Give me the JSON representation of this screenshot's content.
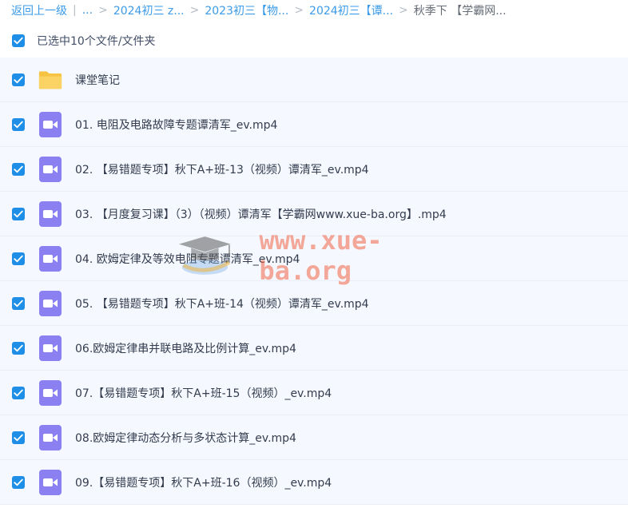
{
  "breadcrumb": {
    "back": "返回上一级",
    "sep": "|",
    "ellipsis": "...",
    "arrow": ">",
    "items": [
      "2024初三 z...",
      "2023初三【物...",
      "2024初三【谭...",
      "秋季下 【学霸网..."
    ]
  },
  "selection": {
    "label": "已选中10个文件/文件夹"
  },
  "files": [
    {
      "name": "课堂笔记",
      "type": "folder"
    },
    {
      "name": "01. 电阻及电路故障专题谭清军_ev.mp4",
      "type": "video"
    },
    {
      "name": "02. 【易错题专项】秋下A+班-13（视频）谭清军_ev.mp4",
      "type": "video"
    },
    {
      "name": "03. 【月度复习课】（3）（视频）谭清军【学霸网www.xue-ba.org】.mp4",
      "type": "video"
    },
    {
      "name": "04. 欧姆定律及等效电阻专题谭清军_ev.mp4",
      "type": "video"
    },
    {
      "name": "05. 【易错题专项】秋下A+班-14（视频）谭清军_ev.mp4",
      "type": "video"
    },
    {
      "name": "06.欧姆定律串并联电路及比例计算_ev.mp4",
      "type": "video"
    },
    {
      "name": "07.【易错题专项】秋下A+班-15（视频）_ev.mp4",
      "type": "video"
    },
    {
      "name": "08.欧姆定律动态分析与多状态计算_ev.mp4",
      "type": "video"
    },
    {
      "name": "09.【易错题专项】秋下A+班-16（视频）_ev.mp4",
      "type": "video"
    }
  ],
  "watermark": {
    "text": "www.xue-ba.org"
  },
  "colors": {
    "accent": "#1e8ee6",
    "link": "#3b9be8",
    "folder": "#f9c94a",
    "video": "#8a7ff0"
  }
}
